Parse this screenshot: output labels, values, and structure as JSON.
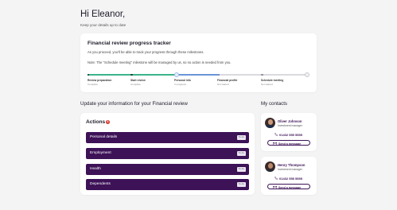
{
  "header": {
    "greeting": "Hi Eleanor,",
    "subtitle": "Keep your details up to date"
  },
  "tracker": {
    "title": "Financial review progress tracker",
    "description": "As you proceed, you'll be able to track your progress through these milestones.",
    "note": "Note: The \"Schedule meeting\" milestone will be managed by us, so no action is needed from you.",
    "steps": [
      {
        "label": "Review preparation",
        "status": "Complete"
      },
      {
        "label": "Start review",
        "status": "Complete"
      },
      {
        "label": "Personal info",
        "status": "In progress"
      },
      {
        "label": "Financial profile",
        "status": "Not started"
      },
      {
        "label": "Schedule meeting",
        "status": "Not started"
      }
    ],
    "colors": {
      "complete": "#3bb58a",
      "progress": "#6a96d8",
      "pending": "#d9d9de"
    }
  },
  "update_section": {
    "title": "Update your information for your Financial review"
  },
  "actions": {
    "heading": "Actions",
    "count": "4",
    "items": [
      {
        "label": "Personal details",
        "tag": "To do"
      },
      {
        "label": "Employment",
        "tag": "To do"
      },
      {
        "label": "Health",
        "tag": "To do"
      },
      {
        "label": "Dependents",
        "tag": "To do"
      }
    ]
  },
  "contacts": {
    "title": "My contacts",
    "items": [
      {
        "name": "Oliver Johnson",
        "role": "Investment manager",
        "phone": "01432 555 5555",
        "button": "Send a message"
      },
      {
        "name": "Henry Thompson",
        "role": "Investment manager",
        "phone": "01432 555 5555",
        "button": "Send a message"
      }
    ]
  },
  "brand": {
    "primary": "#3d1257",
    "alert": "#d63a2f"
  }
}
